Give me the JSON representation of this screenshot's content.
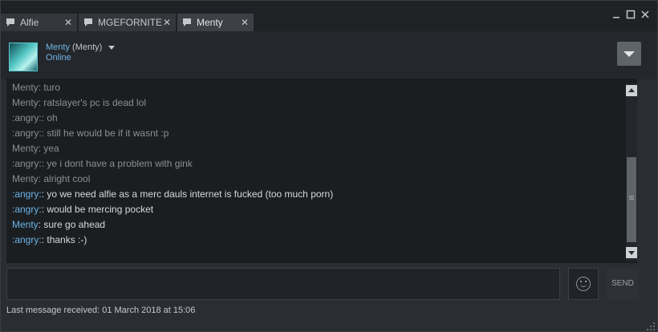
{
  "window": {
    "minimize_icon": "minimize-icon",
    "maximize_icon": "maximize-icon",
    "close_icon": "close-icon"
  },
  "tabs": [
    {
      "label": "Alfie",
      "close": "✕",
      "active": false
    },
    {
      "label": "MGEFORNITE",
      "close": "✕",
      "active": false
    },
    {
      "label": "Menty",
      "close": "✕",
      "active": true
    }
  ],
  "contact": {
    "name": "Menty",
    "nickname": "(Menty)",
    "status": "Online"
  },
  "messages": [
    {
      "speaker": "Menty",
      "text": ": turo",
      "new": false
    },
    {
      "speaker": "Menty",
      "text": ": ratslayer's pc is dead lol",
      "new": false
    },
    {
      "speaker": ":angry:",
      "text": ": oh",
      "new": false
    },
    {
      "speaker": ":angry:",
      "text": ": still he would be if it wasnt :p",
      "new": false
    },
    {
      "speaker": "Menty",
      "text": ": yea",
      "new": false
    },
    {
      "speaker": ":angry:",
      "text": ": ye i dont have a problem with gink",
      "new": false
    },
    {
      "speaker": "Menty",
      "text": ": alright cool",
      "new": false
    },
    {
      "speaker": ":angry:",
      "text": ": yo we need alfie as a merc dauls internet is fucked (too much porn)",
      "new": true
    },
    {
      "speaker": ":angry:",
      "text": ": would be mercing pocket",
      "new": true
    },
    {
      "speaker": "Menty",
      "text": ": sure go ahead",
      "new": true
    },
    {
      "speaker": ":angry:",
      "text": ": thanks :-)",
      "new": true
    }
  ],
  "composer": {
    "placeholder": "",
    "value": "",
    "send_label": "SEND",
    "emoji_icon": "emoticon-icon"
  },
  "footer": {
    "last_message": "Last message received: 01 March 2018 at 15:06"
  },
  "colors": {
    "accent": "#6ab3e6",
    "background": "#2a2d31",
    "chat_background": "#1b1e21"
  }
}
